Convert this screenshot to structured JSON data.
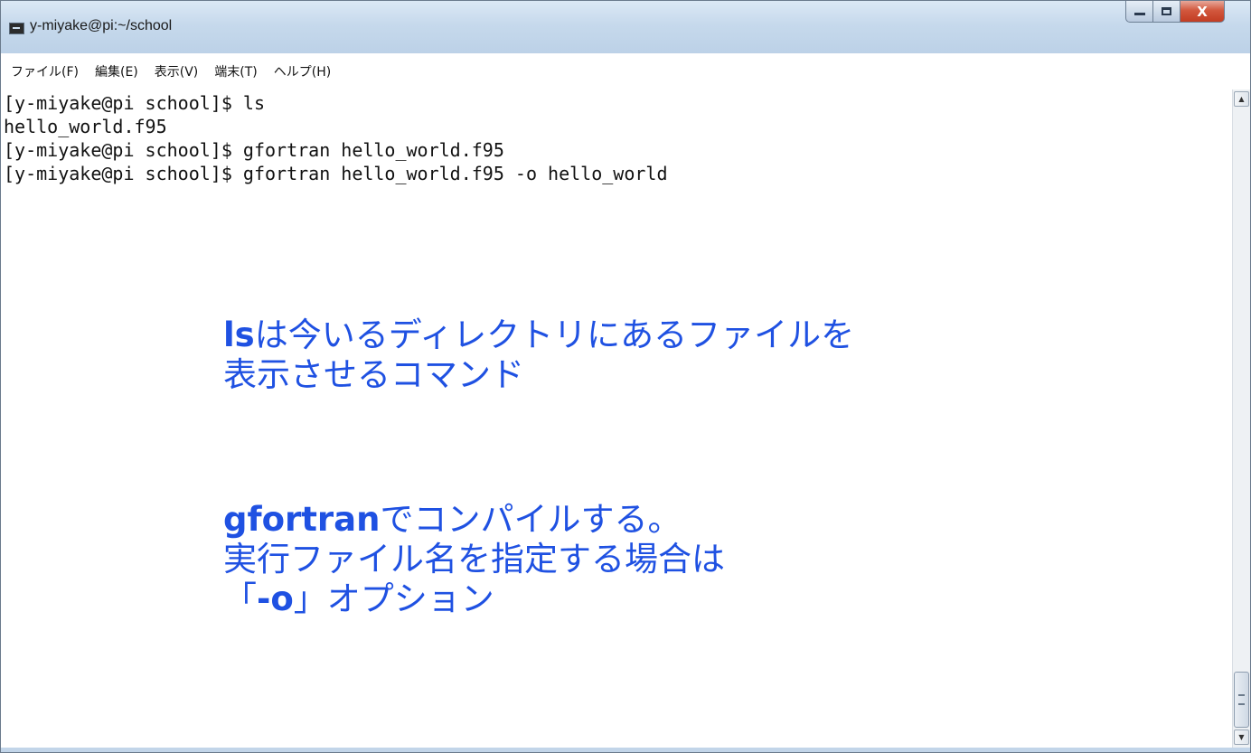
{
  "window": {
    "title": "y-miyake@pi:~/school",
    "minimize_glyph": "minimize-icon",
    "maximize_glyph": "maximize-icon",
    "close_label": "X"
  },
  "menu": {
    "items": [
      {
        "label": "ファイル(F)"
      },
      {
        "label": "編集(E)"
      },
      {
        "label": "表示(V)"
      },
      {
        "label": "端末(T)"
      },
      {
        "label": "ヘルプ(H)"
      }
    ]
  },
  "terminal": {
    "lines": [
      "[y-miyake@pi school]$ ls",
      "hello_world.f95",
      "[y-miyake@pi school]$ gfortran hello_world.f95",
      "[y-miyake@pi school]$ gfortran hello_world.f95 -o hello_world"
    ]
  },
  "annotations": {
    "ls_cmd": "ls",
    "ls_desc_line1_rest": "は今いるディレクトリにあるファイルを",
    "ls_desc_line2": "表示させるコマンド",
    "gfortran_cmd": "gfortran",
    "gfortran_desc_line1_rest": "でコンパイルする。",
    "gfortran_desc_line2": "実行ファイル名を指定する場合は",
    "opt_open": "「",
    "opt_flag": "-o",
    "opt_close_rest": "」オプション"
  },
  "colors": {
    "annotation_text": "#1f51e2",
    "titlebar": "#c6d9ec",
    "close_button": "#c23c22"
  }
}
